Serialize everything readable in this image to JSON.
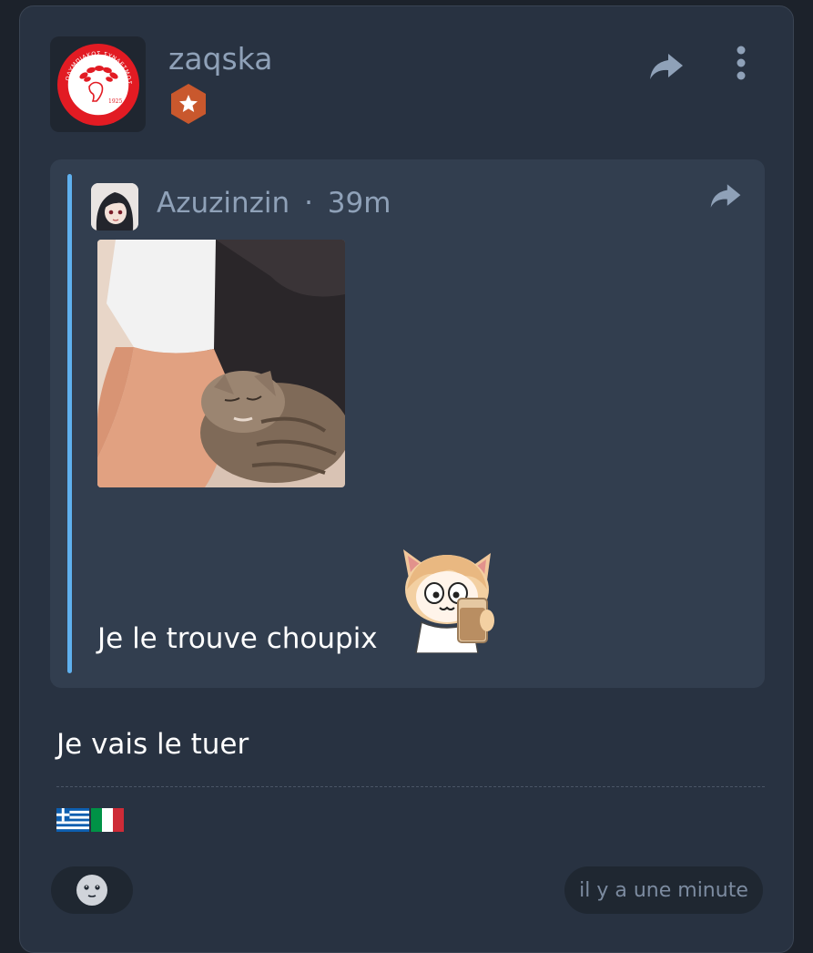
{
  "post": {
    "author": "zaqska",
    "avatar_icon": "olympiacos-crest-icon",
    "avatar_text": "ΟΛΥΜΠΙΑΚΟΣ ΣΥΝΔΕΣΜΟΣ ΦΙΛΑΘΛΩΝ ΠΕΙΡΑΙΩΣ",
    "avatar_year": "1925",
    "rank_badge_icon": "star-hexagon-badge-icon",
    "body": "Je vais le tuer",
    "flags": [
      "🇬🇷",
      "🇮🇹"
    ],
    "timestamp": "il y a une minute"
  },
  "quote": {
    "author": "Azuzinzin",
    "separator": "·",
    "time": "39m",
    "image_description_icon": "kitten-photo",
    "text": "Je le trouve choupix",
    "sticker_icon": "neco-arc-sticker"
  },
  "icons": {
    "share": "share-arrow-icon",
    "more": "kebab-menu-icon",
    "reaction": "emoji-reaction-icon"
  },
  "colors": {
    "card_bg": "#283241",
    "quote_bg": "#323e4f",
    "quote_bar": "#5fb0ee",
    "muted_text": "#8fa1b8",
    "badge": "#c9582d"
  }
}
